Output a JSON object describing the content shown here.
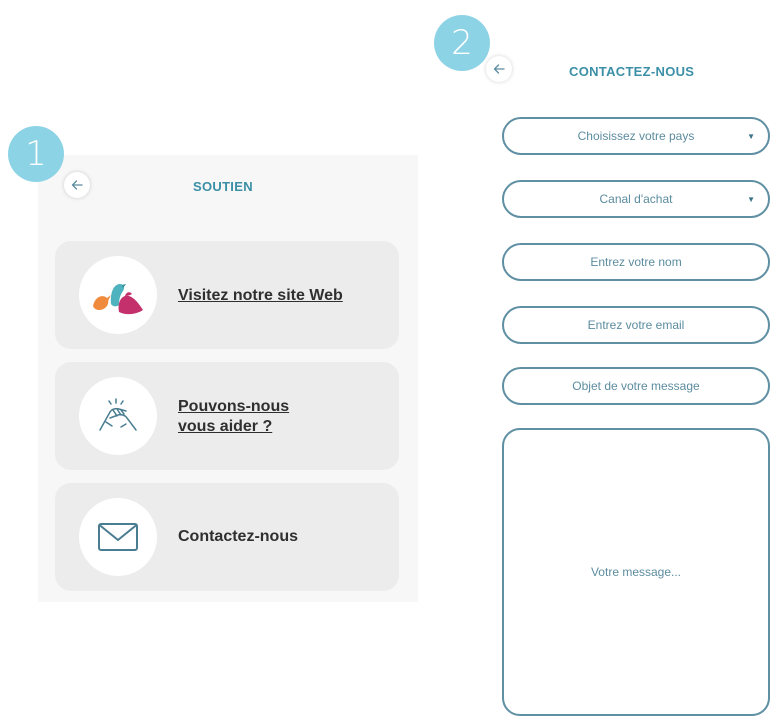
{
  "steps": {
    "first": "1",
    "second": "2"
  },
  "support_screen": {
    "title": "SOUTIEN",
    "back_icon": "arrow-left-icon",
    "items": [
      {
        "label": "Visitez notre site Web",
        "icon": "birds-logo-icon"
      },
      {
        "label": "Pouvons-nous vous aider ?",
        "icon": "handshake-icon"
      },
      {
        "label": "Contactez-nous",
        "icon": "envelope-icon"
      }
    ]
  },
  "contact_screen": {
    "title": "CONTACTEZ-NOUS",
    "back_icon": "arrow-left-icon",
    "fields": {
      "country": "Choisissez votre pays",
      "channel": "Canal d'achat",
      "name": "Entrez votre nom",
      "email": "Entrez votre email",
      "subject": "Objet de votre message",
      "message": "Votre message..."
    }
  },
  "colors": {
    "accent": "#3b8fa6",
    "badge": "#8dd3e6",
    "field_border": "#5f8fa3",
    "card_bg": "#ececec",
    "bird_orange": "#f08a3c",
    "bird_teal": "#4fb3bf",
    "bird_pink": "#c3306b"
  }
}
